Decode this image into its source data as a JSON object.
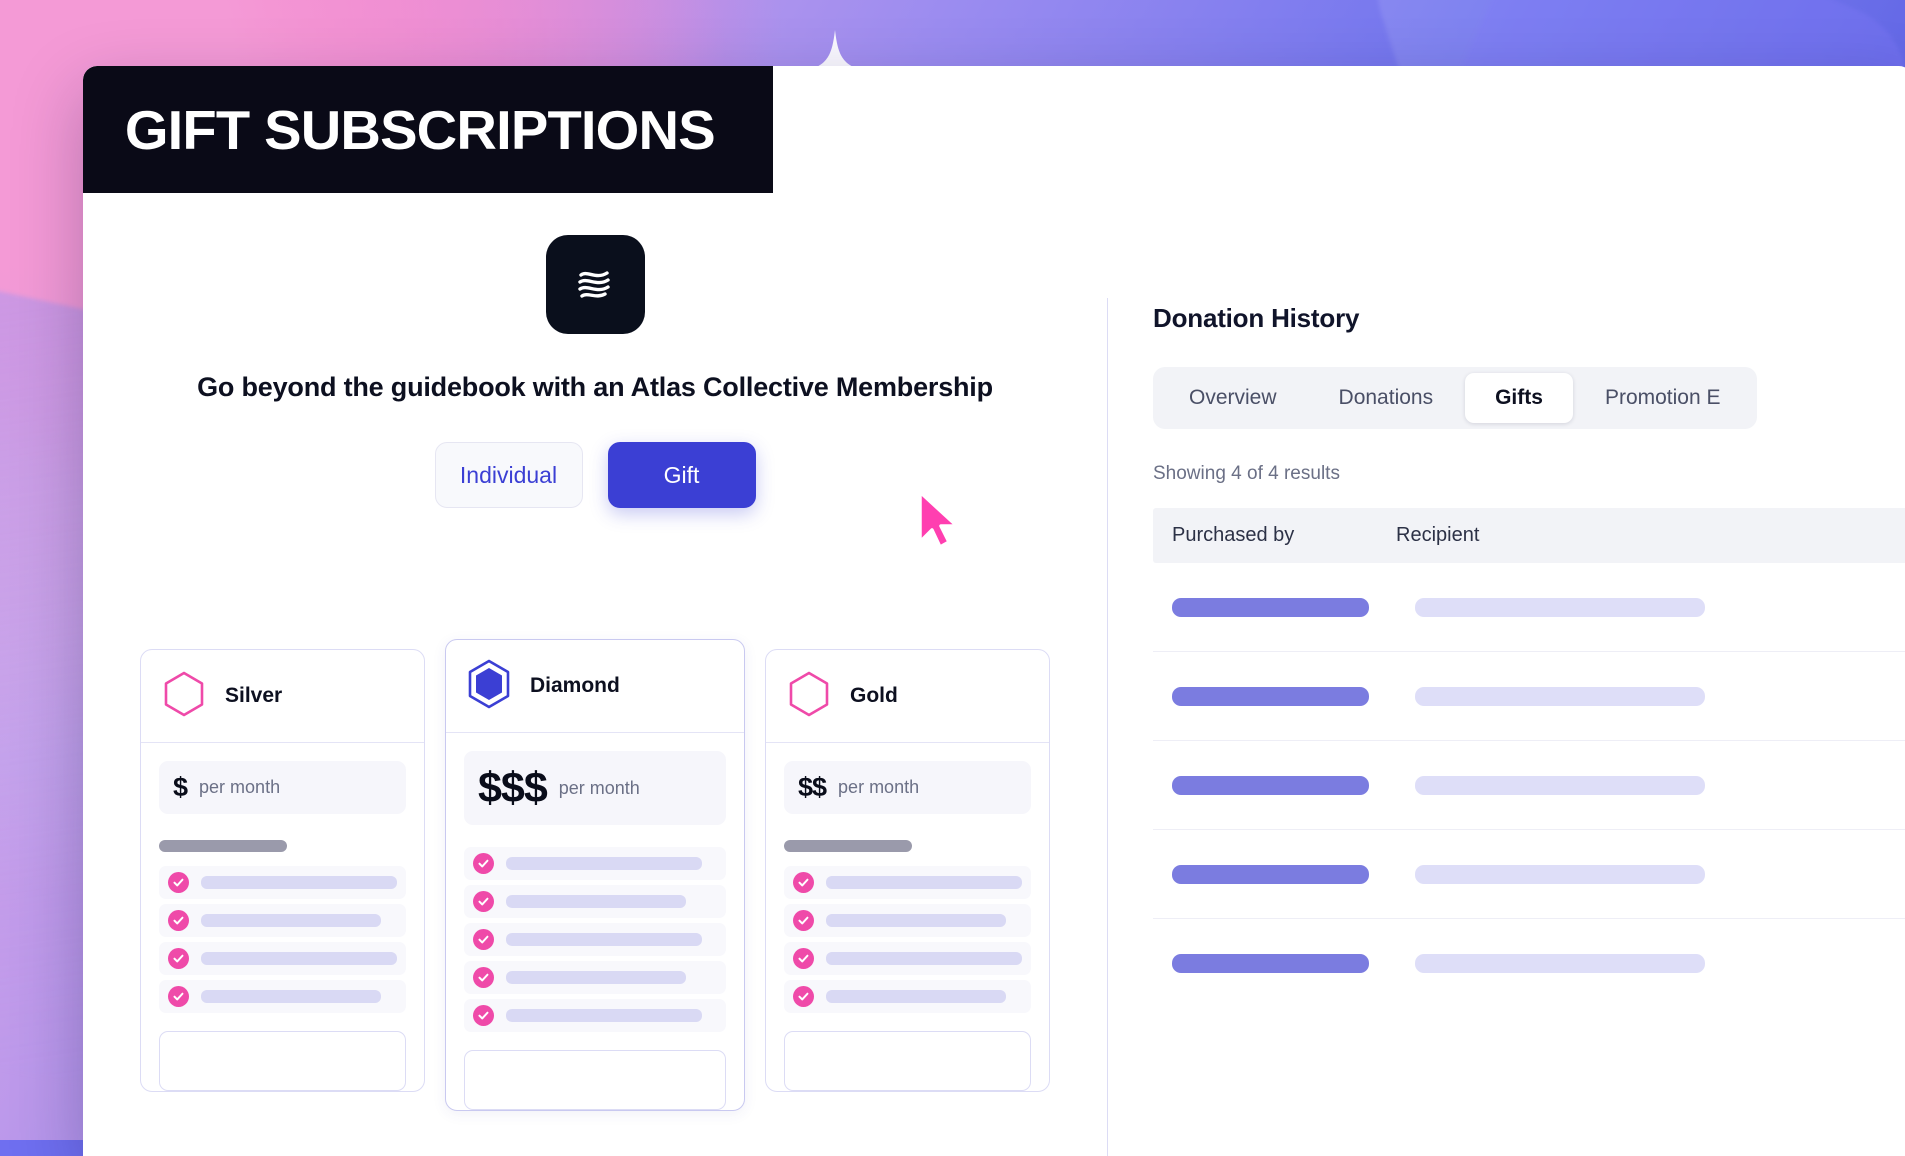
{
  "banner": {
    "title": "GIFT SUBSCRIPTIONS"
  },
  "brand": {
    "logo_icon": "atlas-waves-logo-icon",
    "accent_indigo": "#3b3fd4",
    "accent_pink": "#ef4aa9",
    "dark": "#0a0a17"
  },
  "left": {
    "headline": "Go beyond the guidebook with an Atlas Collective Membership",
    "toggle": {
      "individual_label": "Individual",
      "gift_label": "Gift",
      "selected": "Gift"
    },
    "cursor_icon": "mouse-pointer-icon",
    "plans": [
      {
        "name": "Silver",
        "icon": "hexagon-outline-icon",
        "price_symbols": "$",
        "price_period": "per month",
        "featured": false,
        "feature_bar_widths": [
          196,
          180,
          196,
          180
        ],
        "feature_count": 4
      },
      {
        "name": "Diamond",
        "icon": "hexagon-double-filled-icon",
        "price_symbols": "$$$",
        "price_period": "per month",
        "featured": true,
        "feature_bar_widths": [
          196,
          180,
          196,
          180,
          196
        ],
        "feature_count": 5
      },
      {
        "name": "Gold",
        "icon": "hexagon-outline-icon",
        "price_symbols": "$$",
        "price_period": "per month",
        "featured": false,
        "feature_bar_widths": [
          196,
          180,
          196,
          180
        ],
        "feature_count": 4
      }
    ]
  },
  "right": {
    "title": "Donation History",
    "tabs": [
      {
        "label": "Overview",
        "active": false
      },
      {
        "label": "Donations",
        "active": false
      },
      {
        "label": "Gifts",
        "active": true
      },
      {
        "label": "Promotion E",
        "active": false
      }
    ],
    "results_text": "Showing 4 of 4 results",
    "table": {
      "columns": [
        "Purchased by",
        "Recipient"
      ],
      "rows": [
        {
          "purchased_by_bar": 197,
          "recipient_bar": 290
        },
        {
          "purchased_by_bar": 197,
          "recipient_bar": 290
        },
        {
          "purchased_by_bar": 197,
          "recipient_bar": 290
        },
        {
          "purchased_by_bar": 197,
          "recipient_bar": 290
        },
        {
          "purchased_by_bar": 197,
          "recipient_bar": 290
        }
      ]
    }
  }
}
